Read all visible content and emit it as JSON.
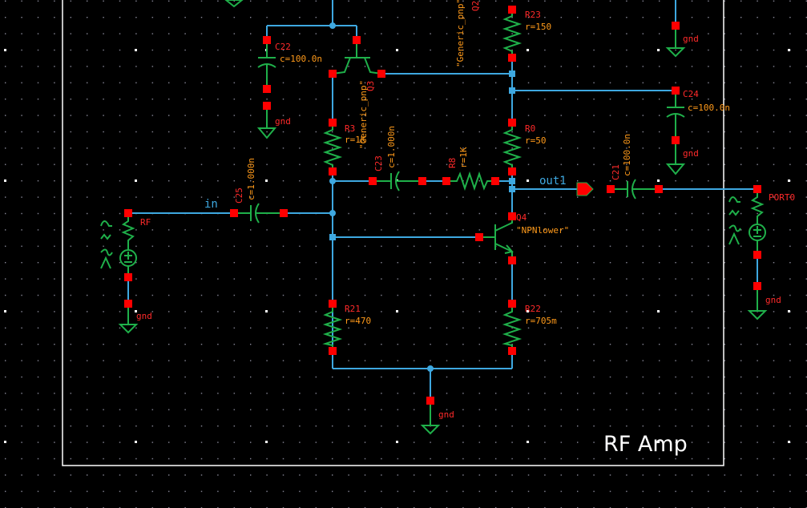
{
  "schematic": {
    "frame_title": "RF Amp",
    "nets": {
      "in": "in",
      "out": "out1"
    },
    "colors": {
      "background": "#000000",
      "wire": "#3ea8e0",
      "symbol": "#1fb04a",
      "pin": "#ff0000",
      "instance_name": "#ff2a2a",
      "parameter": "#ff9a1a"
    },
    "components": {
      "c22": {
        "name": "C22",
        "value": "c=100.0n"
      },
      "q3": {
        "name": "Q3",
        "model": "\"Generic_pnp\""
      },
      "q_top": {
        "name": "Q2",
        "model": "\"Generic_pnp\""
      },
      "r23": {
        "name": "R23",
        "value": "r=150"
      },
      "c24": {
        "name": "C24",
        "value": "c=100.0n"
      },
      "r3": {
        "name": "R3",
        "value": "r=1K"
      },
      "c23": {
        "name": "C23",
        "value": "c=1.000n"
      },
      "r8": {
        "name": "R8",
        "value": "r=1K"
      },
      "r0": {
        "name": "R0",
        "value": "r=50"
      },
      "c21": {
        "name": "C21",
        "value": "c=100.0n"
      },
      "port0": {
        "name": "PORT0"
      },
      "q4": {
        "name": "Q4",
        "model": "\"NPNlower\""
      },
      "c25": {
        "name": "C25",
        "value": "c=1.000n"
      },
      "rf": {
        "name": "RF"
      },
      "r21": {
        "name": "R21",
        "value": "r=470"
      },
      "r22": {
        "name": "R22",
        "value": "r=705m"
      }
    },
    "ground_label": "gnd"
  }
}
